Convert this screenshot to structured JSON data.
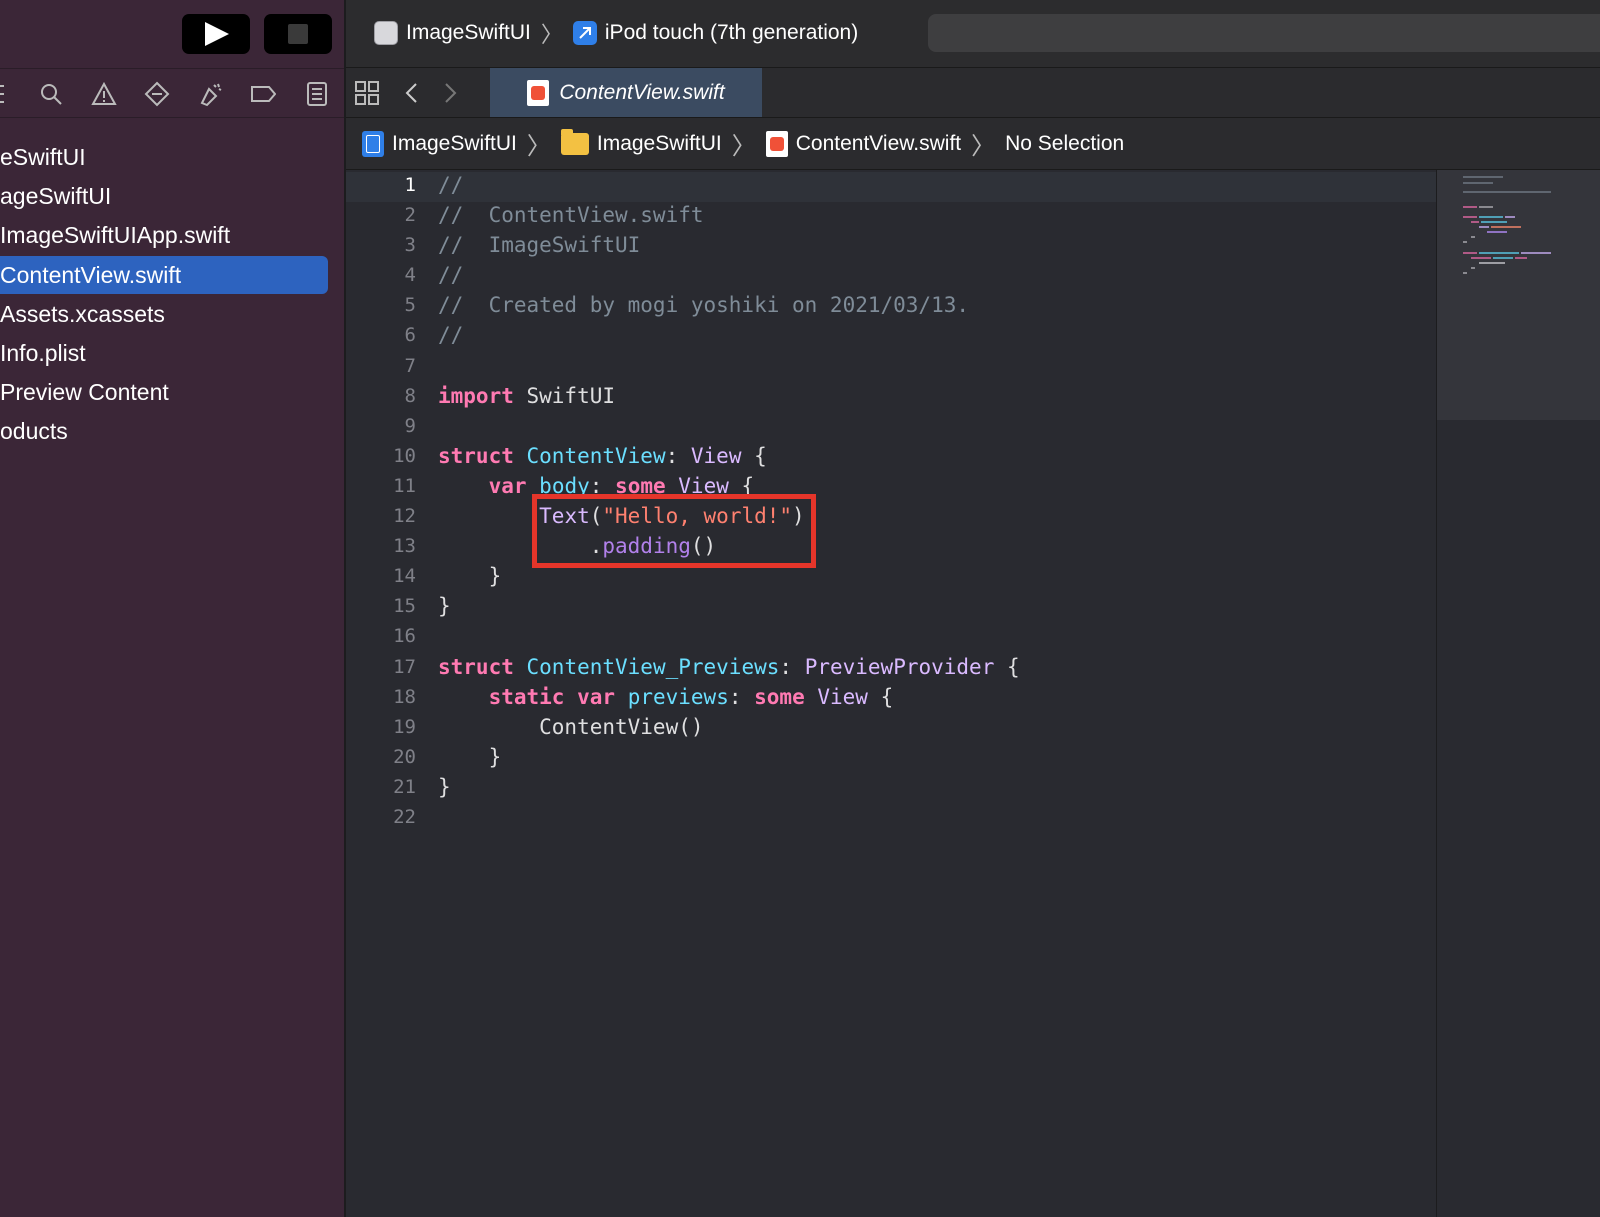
{
  "toolbar": {
    "run_label": "Run",
    "stop_label": "Stop",
    "scheme": "ImageSwiftUI",
    "device": "iPod touch (7th generation)"
  },
  "navigator_icons": [
    "hierarchy-icon",
    "search-icon",
    "warning-icon",
    "breakpoint-icon",
    "debug-icon",
    "tag-icon",
    "report-icon"
  ],
  "file_tree": [
    {
      "label": "eSwiftUI"
    },
    {
      "label": "ageSwiftUI"
    },
    {
      "label": "ImageSwiftUIApp.swift"
    },
    {
      "label": "ContentView.swift",
      "selected": true
    },
    {
      "label": "Assets.xcassets"
    },
    {
      "label": "Info.plist"
    },
    {
      "label": "Preview Content"
    },
    {
      "label": "oducts"
    }
  ],
  "tab": {
    "label": "ContentView.swift"
  },
  "jumpbar": {
    "project": "ImageSwiftUI",
    "folder": "ImageSwiftUI",
    "file": "ContentView.swift",
    "selection": "No Selection"
  },
  "editor": {
    "line_numbers": [
      "1",
      "2",
      "3",
      "4",
      "5",
      "6",
      "7",
      "8",
      "9",
      "10",
      "11",
      "12",
      "13",
      "14",
      "15",
      "16",
      "17",
      "18",
      "19",
      "20",
      "21",
      "22"
    ],
    "current_line": 1,
    "code": {
      "l1": "//",
      "l2": "//  ContentView.swift",
      "l3": "//  ImageSwiftUI",
      "l4": "//",
      "l5": "//  Created by mogi yoshiki on 2021/03/13.",
      "l6": "//",
      "l8_kw": "import",
      "l8_rest": " SwiftUI",
      "l10_kw": "struct",
      "l10_name": "ContentView",
      "l10_colon": ": ",
      "l10_type": "View",
      "l10_brace": " {",
      "l11_indent": "    ",
      "l11_kw": "var",
      "l11_name": "body",
      "l11_colon": ": ",
      "l11_kw2": "some",
      "l11_type": "View",
      "l11_brace": " {",
      "l12_indent": "        ",
      "l12_fn": "Text",
      "l12_open": "(",
      "l12_str": "\"Hello, world!\"",
      "l12_close": ")",
      "l13_indent": "            .",
      "l13_fn": "padding",
      "l13_paren": "()",
      "l14": "    }",
      "l15": "}",
      "l17_kw": "struct",
      "l17_name": "ContentView_Previews",
      "l17_colon": ": ",
      "l17_type": "PreviewProvider",
      "l17_brace": " {",
      "l18_indent": "    ",
      "l18_kw": "static",
      "l18_kw2": "var",
      "l18_name": "previews",
      "l18_colon": ": ",
      "l18_kw3": "some",
      "l18_type": "View",
      "l18_brace": " {",
      "l19": "        ContentView()",
      "l20": "    }",
      "l21": "}"
    }
  },
  "colors": {
    "sidebar_bg": "#3b2637",
    "selection": "#2d63bf",
    "editor_bg": "#292a30",
    "keyword": "#ff7ab2",
    "type": "#6bdfff",
    "string": "#ff8170",
    "comment": "#7f8c98",
    "highlight_box": "#e5352a"
  }
}
